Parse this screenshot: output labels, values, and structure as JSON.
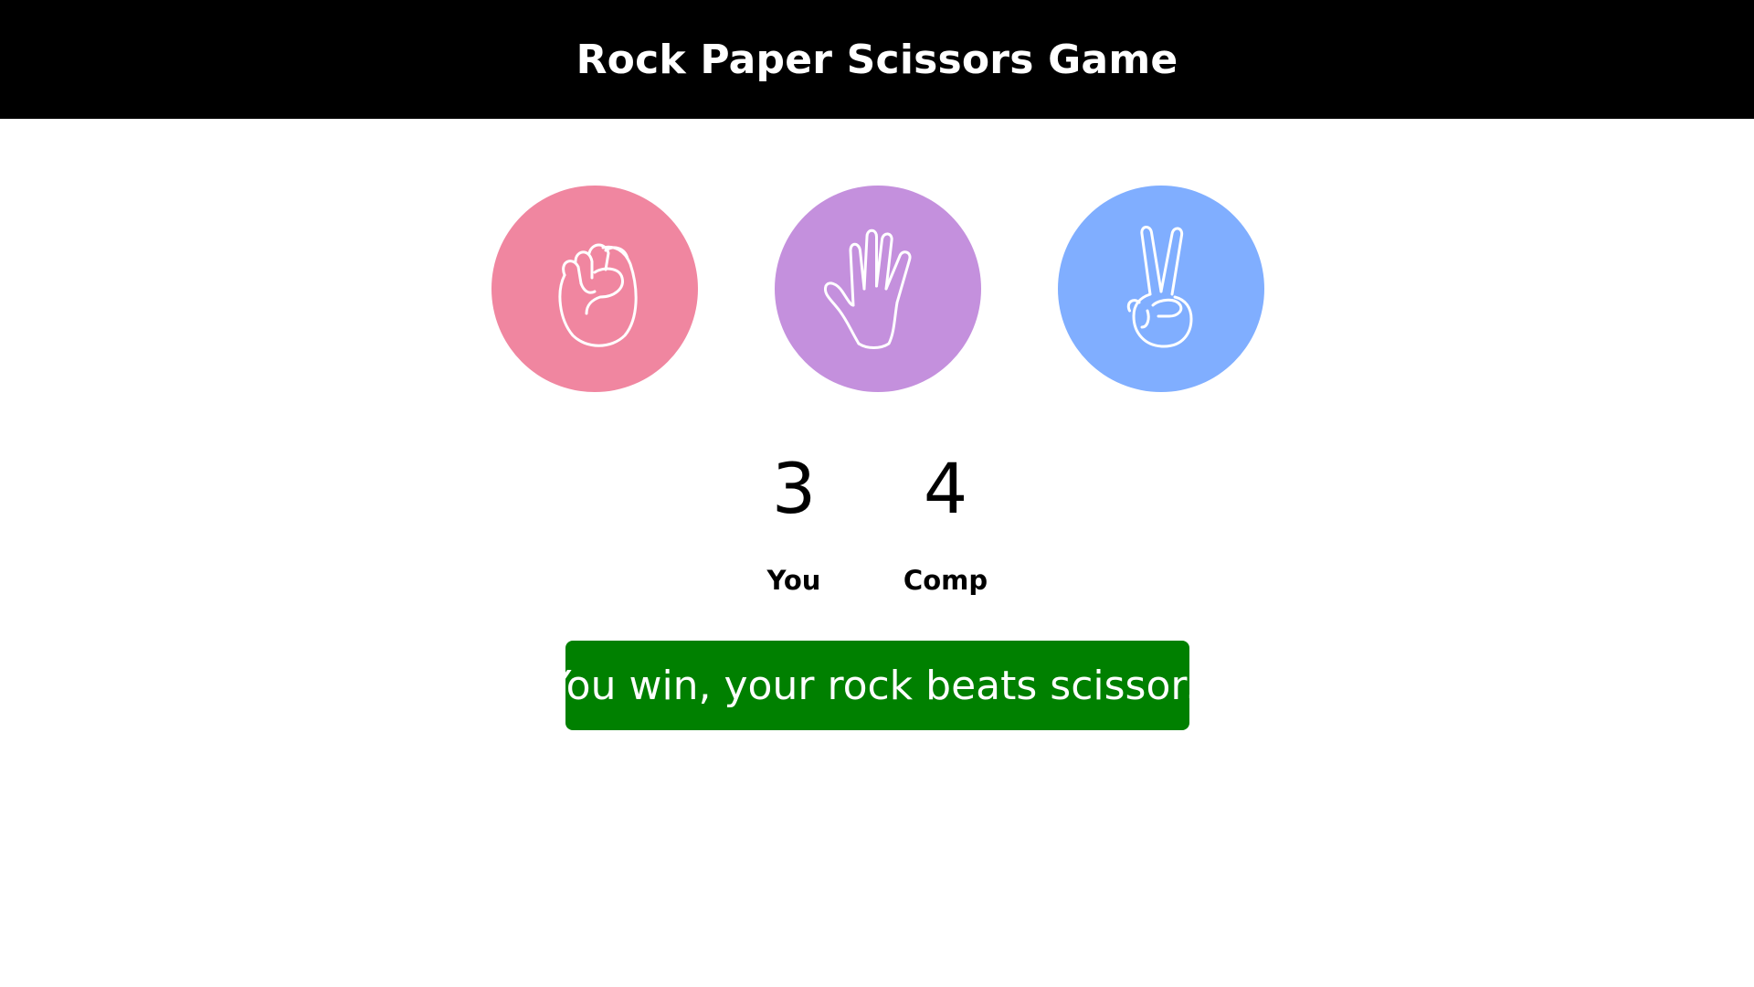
{
  "header": {
    "title": "Rock Paper Scissors Game"
  },
  "choices": [
    {
      "id": "rock",
      "icon": "fist-icon",
      "color": "#F086A0"
    },
    {
      "id": "paper",
      "icon": "open-hand-icon",
      "color": "#C490DD"
    },
    {
      "id": "scissors",
      "icon": "peace-hand-icon",
      "color": "#80AEFF"
    }
  ],
  "score": {
    "user": {
      "value": "3",
      "label": "You"
    },
    "comp": {
      "value": "4",
      "label": "Comp"
    }
  },
  "message": {
    "text": "You win, your rock beats scissors",
    "color": "#008000"
  }
}
